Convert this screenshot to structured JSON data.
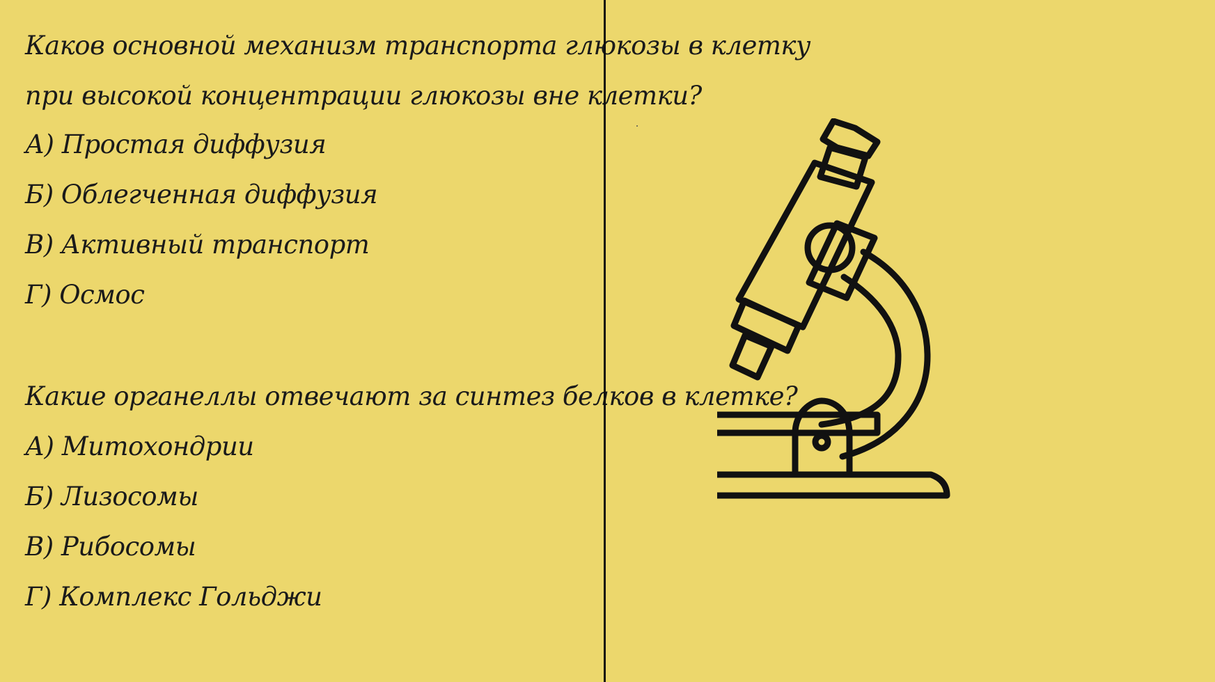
{
  "quiz": {
    "q1": {
      "line1": "Каков основной механизм транспорта глюкозы в клетку",
      "line2": "при высокой концентрации глюкозы вне клетки?",
      "options": [
        "А) Простая диффузия",
        "Б) Облегченная диффузия",
        "В) Активный транспорт",
        "Г) Осмос"
      ]
    },
    "q2": {
      "question": "Какие органеллы отвечают за синтез белков в клетке?",
      "options": [
        "А) Митохондрии",
        "Б) Лизосомы",
        "В) Рибосомы",
        "Г) Комплекс Гольджи"
      ]
    }
  },
  "illustration": {
    "icon": "microscope-icon",
    "stroke_color": "#111111"
  },
  "colors": {
    "background": "#ecd76c",
    "text": "#1a1a1a",
    "divider": "#111111"
  }
}
